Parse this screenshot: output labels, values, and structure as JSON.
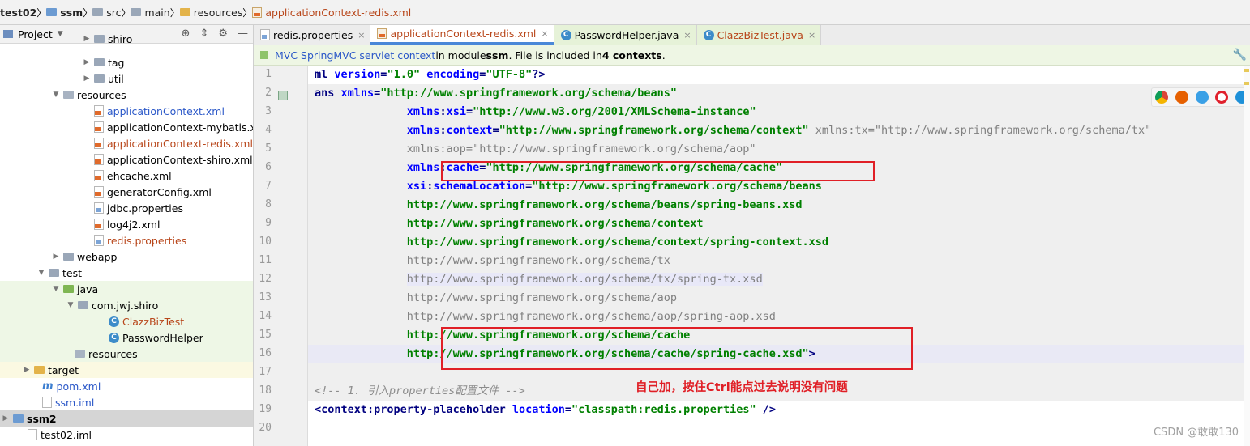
{
  "breadcrumb": {
    "items": [
      "test02",
      "ssm",
      "src",
      "main",
      "resources",
      "applicationContext-redis.xml"
    ]
  },
  "project": {
    "title": "Project",
    "tree": [
      {
        "label": "shiro",
        "type": "folder"
      },
      {
        "label": "tag",
        "type": "folder"
      },
      {
        "label": "util",
        "type": "folder"
      },
      {
        "label": "resources",
        "type": "folder-res"
      },
      {
        "label": "applicationContext.xml",
        "type": "xml"
      },
      {
        "label": "applicationContext-mybatis.xml",
        "type": "xml"
      },
      {
        "label": "applicationContext-redis.xml",
        "type": "xml"
      },
      {
        "label": "applicationContext-shiro.xml",
        "type": "xml"
      },
      {
        "label": "ehcache.xml",
        "type": "xml"
      },
      {
        "label": "generatorConfig.xml",
        "type": "xml"
      },
      {
        "label": "jdbc.properties",
        "type": "properties"
      },
      {
        "label": "log4j2.xml",
        "type": "xml"
      },
      {
        "label": "redis.properties",
        "type": "properties"
      },
      {
        "label": "webapp",
        "type": "folder"
      },
      {
        "label": "test",
        "type": "folder"
      },
      {
        "label": "java",
        "type": "folder-green"
      },
      {
        "label": "com.jwj.shiro",
        "type": "package"
      },
      {
        "label": "ClazzBizTest",
        "type": "class"
      },
      {
        "label": "PasswordHelper",
        "type": "class"
      },
      {
        "label": "resources",
        "type": "folder-res"
      },
      {
        "label": "target",
        "type": "folder-yellow"
      },
      {
        "label": "pom.xml",
        "type": "maven"
      },
      {
        "label": "ssm.iml",
        "type": "iml"
      },
      {
        "label": "ssm2",
        "type": "module"
      },
      {
        "label": "test02.iml",
        "type": "iml"
      }
    ]
  },
  "tabs": [
    {
      "label": "redis.properties"
    },
    {
      "label": "applicationContext-redis.xml"
    },
    {
      "label": "PasswordHelper.java"
    },
    {
      "label": "ClazzBizTest.java"
    }
  ],
  "notice": {
    "part1": "MVC SpringMVC servlet context",
    "part2": " in module ",
    "module": "ssm",
    "part3": ". File is included in ",
    "count": "4 contexts",
    "part4": "."
  },
  "editor": {
    "line_numbers": [
      "1",
      "2",
      "3",
      "4",
      "5",
      "6",
      "7",
      "8",
      "9",
      "10",
      "11",
      "12",
      "13",
      "14",
      "15",
      "16",
      "17",
      "18",
      "19",
      "20"
    ],
    "lines": [
      [
        {
          "c": "tg",
          "t": "ml "
        },
        {
          "c": "at",
          "t": "version"
        },
        {
          "c": "tg",
          "t": "="
        },
        {
          "c": "vl",
          "t": "\"1.0\""
        },
        {
          "c": "tg",
          "t": " "
        },
        {
          "c": "at",
          "t": "encoding"
        },
        {
          "c": "tg",
          "t": "="
        },
        {
          "c": "vl",
          "t": "\"UTF-8\""
        },
        {
          "c": "tg",
          "t": "?>"
        }
      ],
      [
        {
          "c": "tg",
          "t": "ans "
        },
        {
          "c": "at",
          "t": "xmlns"
        },
        {
          "c": "tg",
          "t": "="
        },
        {
          "c": "vl",
          "t": "\"http://www.springframework.org/schema/beans\""
        }
      ],
      [
        {
          "c": "tg",
          "t": "              "
        },
        {
          "c": "at",
          "t": "xmlns"
        },
        {
          "c": "tg",
          "t": ":"
        },
        {
          "c": "at",
          "t": "xsi"
        },
        {
          "c": "tg",
          "t": "="
        },
        {
          "c": "vl",
          "t": "\"http://www.w3.org/2001/XMLSchema-instance\""
        }
      ],
      [
        {
          "c": "tg",
          "t": "              "
        },
        {
          "c": "at",
          "t": "xmlns"
        },
        {
          "c": "tg",
          "t": ":"
        },
        {
          "c": "at",
          "t": "context"
        },
        {
          "c": "tg",
          "t": "="
        },
        {
          "c": "vl",
          "t": "\"http://www.springframework.org/schema/context\""
        },
        {
          "c": "gy",
          "t": " xmlns:tx=\"http://www.springframework.org/schema/tx\""
        }
      ],
      [
        {
          "c": "gy",
          "t": "              xmlns:aop=\"http://www.springframework.org/schema/aop\""
        }
      ],
      [
        {
          "c": "tg",
          "t": "              "
        },
        {
          "c": "at",
          "t": "xmlns"
        },
        {
          "c": "tg",
          "t": ":"
        },
        {
          "c": "at",
          "t": "cache"
        },
        {
          "c": "tg",
          "t": "="
        },
        {
          "c": "vl",
          "t": "\"http://www.springframework.org/schema/cache\""
        }
      ],
      [
        {
          "c": "tg",
          "t": "              "
        },
        {
          "c": "at",
          "t": "xsi"
        },
        {
          "c": "tg",
          "t": ":"
        },
        {
          "c": "at",
          "t": "schemaLocation"
        },
        {
          "c": "tg",
          "t": "="
        },
        {
          "c": "vl",
          "t": "\"http://www.springframework.org/schema/beans"
        }
      ],
      [
        {
          "c": "vl",
          "t": "              http://www.springframework.org/schema/beans/spring-beans.xsd"
        }
      ],
      [
        {
          "c": "vl",
          "t": "              http://www.springframework.org/schema/context"
        }
      ],
      [
        {
          "c": "vl",
          "t": "              http://www.springframework.org/schema/context/spring-context.xsd"
        }
      ],
      [
        {
          "c": "gy",
          "t": "              http://www.springframework.org/schema/tx"
        }
      ],
      [
        {
          "c": "gy",
          "t": "              "
        },
        {
          "c": "gy hl",
          "t": "http://www.springframework.org/schema/tx/spring-tx.xsd"
        }
      ],
      [
        {
          "c": "gy",
          "t": "              http://www.springframework.org/schema/aop"
        }
      ],
      [
        {
          "c": "gy",
          "t": "              http://www.springframework.org/schema/aop/spring-aop.xsd"
        }
      ],
      [
        {
          "c": "vl",
          "t": "              http://www.springframework.org/schema/cache"
        }
      ],
      [
        {
          "c": "vl",
          "t": "              http://www.springframework.org/schema/cache/spring-cache.xsd\""
        },
        {
          "c": "tg",
          "t": ">"
        }
      ],
      [
        {
          "c": "tg",
          "t": ""
        }
      ],
      [
        {
          "c": "cm",
          "t": "<!-- 1. 引入properties配置文件 -->"
        }
      ],
      [
        {
          "c": "tg",
          "t": "<context:property-placeholder "
        },
        {
          "c": "at",
          "t": "location"
        },
        {
          "c": "tg",
          "t": "="
        },
        {
          "c": "vl",
          "t": "\"classpath:redis.properties\""
        },
        {
          "c": "tg",
          "t": " />"
        }
      ],
      [
        {
          "c": "tg",
          "t": ""
        }
      ]
    ],
    "annotation": "自己加，按住Ctrl能点过去说明没有问题",
    "watermark": "CSDN @敢敢130"
  },
  "colors": {
    "red_annotation": "#e01f26",
    "xml_tag": "#000080",
    "xml_value": "#008000",
    "xml_attr": "#0000ff"
  }
}
